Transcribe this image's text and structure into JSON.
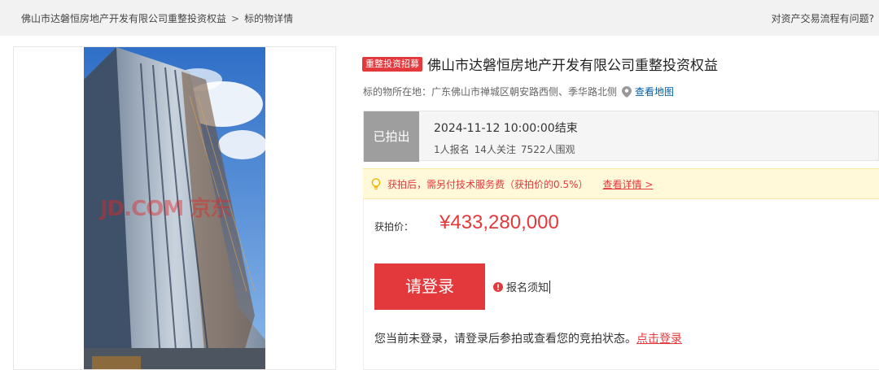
{
  "breadcrumb": {
    "item1": "佛山市达磐恒房地产开发有限公司重整投资权益",
    "separator": ">",
    "item2": "标的物详情"
  },
  "help_link": "对资产交易流程有问题?",
  "photo": {
    "watermark": "JD.COM 京东"
  },
  "listing": {
    "badge": "重整投资招募",
    "title": "佛山市达磐恒房地产开发有限公司重整投资权益",
    "location_label": "标的物所在地：",
    "location_value": "广东佛山市禅城区朝安路西侧、季华路北侧",
    "map_link": "查看地图"
  },
  "status": {
    "badge": "已拍出",
    "end_time": "2024-11-12 10:00:00结束",
    "signups": "1人报名",
    "followers": "14人关注",
    "viewers": "7522人围观"
  },
  "notice": {
    "text": "获拍后，需另付技术服务费（获拍价的0.5%）",
    "link": "查看详情 >"
  },
  "price": {
    "label": "获拍价：",
    "value": "¥433,280,000"
  },
  "actions": {
    "login_button": "请登录",
    "rules_link": "报名须知"
  },
  "login_hint": {
    "text": "您当前未登录，请登录后参拍或查看您的竞拍状态。",
    "link": "点击登录"
  },
  "colors": {
    "accent": "#e4393c",
    "status_badge": "#9e9e9e",
    "link": "#005ea7",
    "notice_bg": "#fff8d9"
  },
  "icons": [
    "location-pin-icon",
    "lightbulb-icon",
    "warning-icon"
  ]
}
